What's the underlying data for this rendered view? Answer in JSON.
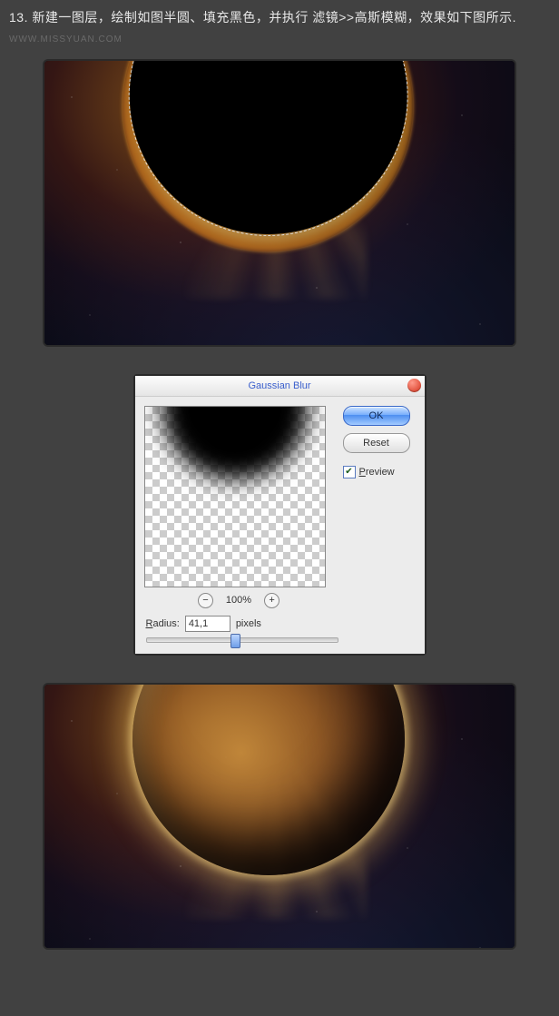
{
  "step": {
    "number": "13.",
    "text_part1": "新建一图层，绘制如图半圆、填充黑色，并执行 滤镜>>高斯模糊，效果如下图所示.",
    "watermark": "WWW.MISSYUAN.COM"
  },
  "dialog": {
    "title": "Gaussian Blur",
    "ok_label": "OK",
    "reset_label": "Reset",
    "preview_label": "Preview",
    "preview_checked": true,
    "zoom_level": "100%",
    "radius_label": "Radius:",
    "radius_value": "41,1",
    "radius_unit": "pixels"
  }
}
